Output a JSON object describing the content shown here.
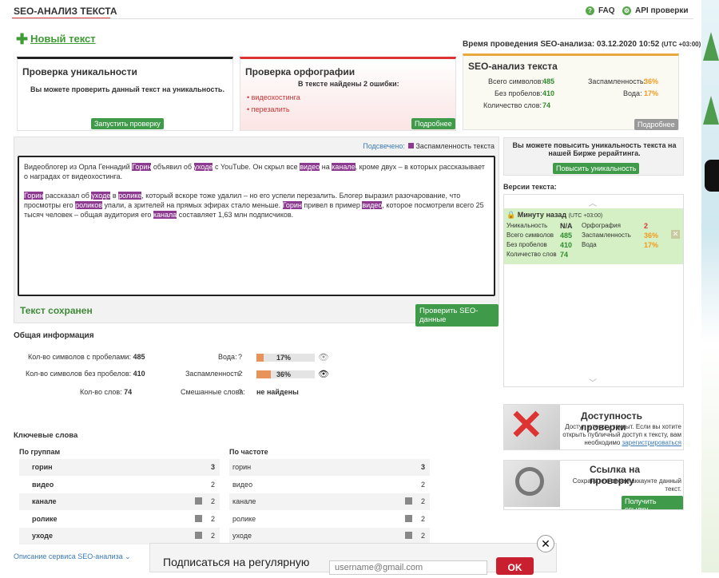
{
  "header": {
    "title": "SEO-АНАЛИЗ ТЕКСТА",
    "faq": "FAQ",
    "api": "API проверки"
  },
  "new_text": "Новый текст",
  "analysis_time": {
    "label": "Время проведения SEO-анализа: 03.12.2020 10:52",
    "tz": "(UTC +03:00)"
  },
  "uniqueness": {
    "title": "Проверка уникальности",
    "text": "Вы можете проверить данный текст на уникальность.",
    "button": "Запустить проверку"
  },
  "spelling": {
    "title": "Проверка орфографии",
    "summary": "В тексте найдены 2 ошибки:",
    "errors": [
      "видеохостинга",
      "перезалить"
    ],
    "button": "Подробнее"
  },
  "seo": {
    "title": "SEO-анализ текста",
    "total_label": "Всего символов:",
    "total": "485",
    "nospace_label": "Без пробелов:",
    "nospace": "410",
    "words_label": "Количество слов:",
    "words": "74",
    "spam_label": "Заспамленность:",
    "spam": "36%",
    "water_label": "Вода:",
    "water": "17%",
    "button": "Подробнее"
  },
  "editor": {
    "highlighted": "Подсвечено:",
    "legend": "Заспамленность текста",
    "saved": "Текст сохранен",
    "check_button": "Проверить SEO-данные",
    "p1": [
      [
        "Видеоблогер из Орла Геннадий ",
        0
      ],
      [
        "Горин",
        1
      ],
      [
        " объявил об ",
        0
      ],
      [
        "уходе",
        1
      ],
      [
        " с YouTube. Он скрыл все ",
        0
      ],
      [
        "видео",
        1
      ],
      [
        " на ",
        0
      ],
      [
        "канале",
        1
      ],
      [
        ", кроме двух – в которых рассказывает о наградах от видеохостинга.",
        0
      ]
    ],
    "p2": [
      [
        "Горин",
        1
      ],
      [
        " рассказал об ",
        0
      ],
      [
        "уходе",
        1
      ],
      [
        " в ",
        0
      ],
      [
        "ролике",
        1
      ],
      [
        ", который вскоре тоже удалил – но его успели перезалить. Блогер выразил разочарование, что просмотры его ",
        0
      ],
      [
        "роликов",
        1
      ],
      [
        " упали, а зрителей на прямых эфирах стало меньше. ",
        0
      ],
      [
        "Горин",
        1
      ],
      [
        " привел в пример ",
        0
      ],
      [
        "видео",
        1
      ],
      [
        ", которое посмотрели всего 25 тысяч человек – общая аудитория его ",
        0
      ],
      [
        "канала",
        1
      ],
      [
        " составляет 1,63 млн подписчиков.",
        0
      ]
    ]
  },
  "general": {
    "title": "Общая информация",
    "r1_label": "Кол-во символов с пробелами:",
    "r1": "485",
    "r2_label": "Кол-во символов без пробелов:",
    "r2": "410",
    "r3_label": "Кол-во слов:",
    "r3": "74",
    "water_label": "Вода:",
    "water": "17%",
    "water_value": 0.17,
    "spam_label": "Заспамленность:",
    "spam": "36%",
    "spam_value": 0.36,
    "mixed_label": "Смешанные слова:",
    "mixed": "не найдены",
    "q": "?"
  },
  "keywords": {
    "title": "Ключевые слова",
    "groups_title": "По группам",
    "freq_title": "По частоте",
    "groups": [
      [
        "горин",
        "3"
      ],
      [
        "видео",
        "2"
      ],
      [
        "канале",
        "2"
      ],
      [
        "ролике",
        "2"
      ],
      [
        "уходе",
        "2"
      ]
    ],
    "freq": [
      [
        "горин",
        "3"
      ],
      [
        "видео",
        "2"
      ],
      [
        "канале",
        "2"
      ],
      [
        "ролике",
        "2"
      ],
      [
        "уходе",
        "2"
      ]
    ]
  },
  "service_link": "Описание сервиса SEO-анализа",
  "improve": {
    "text": "Вы можете повысить уникальность текста на нашей Бирже рерайтинга.",
    "button": "Повысить уникальность"
  },
  "versions": {
    "title": "Версии текста:",
    "item_time": "Минуту назад",
    "item_tz": "(UTC +03:00)",
    "uniq_label": "Уникальность",
    "uniq": "N/A",
    "total_label": "Всего символов",
    "total": "485",
    "nospace_label": "Без пробелов",
    "nospace": "410",
    "words_label": "Количество слов",
    "words": "74",
    "spell_label": "Орфография",
    "spell": "2",
    "spam_label": "Заспамленность",
    "spam": "36%",
    "water_label": "Вода",
    "water": "17%"
  },
  "access": {
    "title": "Доступность проверки",
    "text": "Доступ к тексту закрыт. Если вы хотите открыть публичный доступ к тексту, вам необходимо",
    "link": "зарегистрироваться"
  },
  "share": {
    "title": "Ссылка на проверку",
    "text": "Сохраните в своем аккаунте данный текст.",
    "button": "Получить ссылку"
  },
  "popup": {
    "text": "Подписаться на регулярную",
    "placeholder": "username@gmail.com",
    "ok": "OK",
    "close": "✕"
  }
}
